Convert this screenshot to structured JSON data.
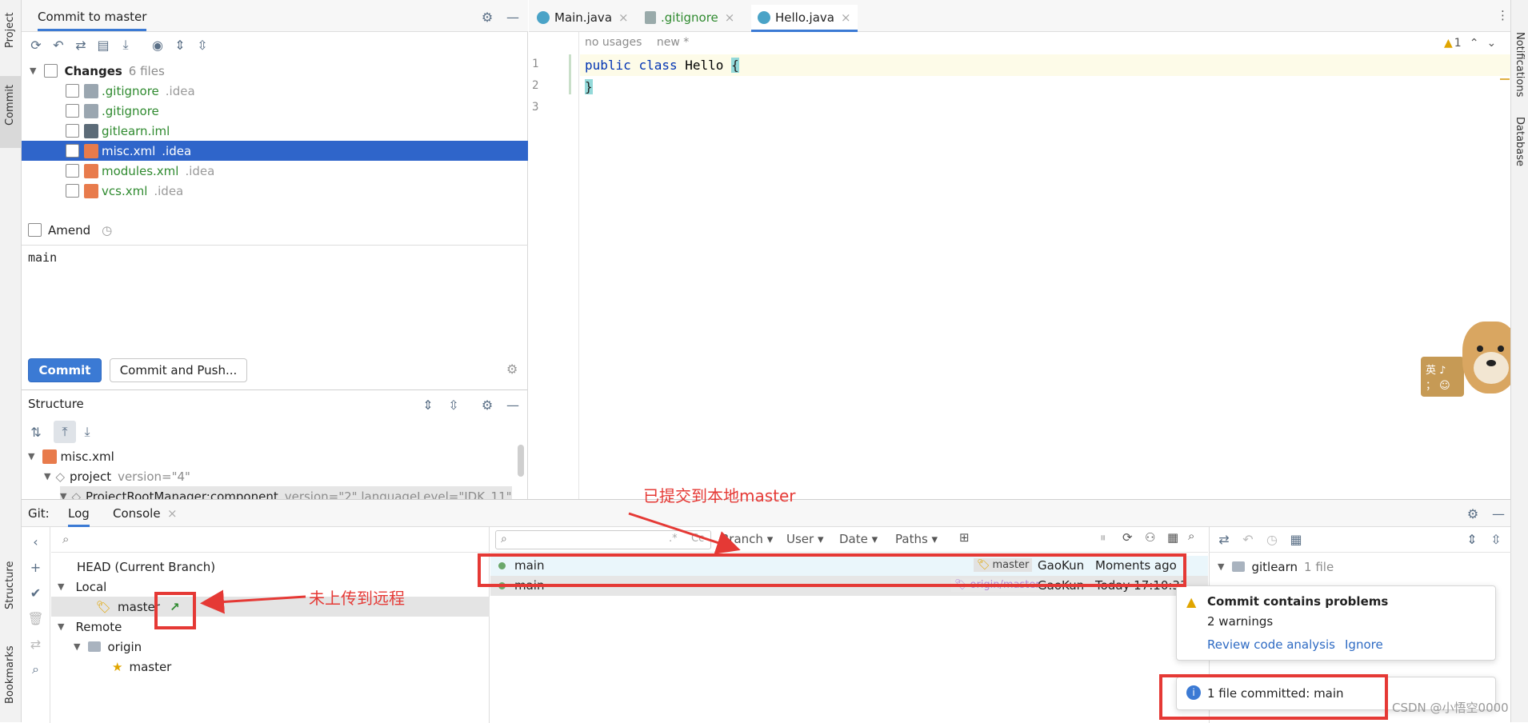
{
  "left_strip": {
    "project": "Project",
    "commit": "Commit",
    "structure": "Structure",
    "bookmarks": "Bookmarks"
  },
  "right_strip": {
    "notifications": "Notifications",
    "database": "Database"
  },
  "commit_panel": {
    "title": "Commit to master",
    "changes_label": "Changes",
    "changes_count": "6 files",
    "files": [
      {
        "name": ".gitignore",
        "dir": ".idea",
        "color": "#2f8a2f"
      },
      {
        "name": ".gitignore",
        "dir": "",
        "color": "#2f8a2f"
      },
      {
        "name": "gitlearn.iml",
        "dir": "",
        "color": "#2f8a2f"
      },
      {
        "name": "misc.xml",
        "dir": ".idea",
        "color": "#ffffff"
      },
      {
        "name": "modules.xml",
        "dir": ".idea",
        "color": "#2f8a2f"
      },
      {
        "name": "vcs.xml",
        "dir": ".idea",
        "color": "#2f8a2f"
      }
    ],
    "amend_label": "Amend",
    "message": "main",
    "commit_button": "Commit",
    "commit_push_button": "Commit and Push..."
  },
  "structure": {
    "title": "Structure",
    "nodes": [
      {
        "label": "misc.xml",
        "attr": ""
      },
      {
        "label": "project",
        "attr": "version=\"4\""
      },
      {
        "label": "ProjectRootManager:component",
        "attr": "version=\"2\" languageLevel=\"JDK_11\""
      }
    ]
  },
  "editor": {
    "tabs": [
      {
        "label": "Main.java",
        "color": "#222222"
      },
      {
        "label": ".gitignore",
        "color": "#2f8a2f"
      },
      {
        "label": "Hello.java",
        "color": "#222222"
      }
    ],
    "hint_usages": "no usages",
    "hint_new": "new *",
    "warning_count": "1",
    "line_numbers": [
      "1",
      "2",
      "3"
    ],
    "code_kw1": "public",
    "code_kw2": "class",
    "code_name": "Hello",
    "code_open": "{",
    "code_close": "}"
  },
  "bottom": {
    "git_label": "Git:",
    "tab_log": "Log",
    "tab_console": "Console",
    "branches": {
      "head": "HEAD (Current Branch)",
      "local": "Local",
      "local_master": "master",
      "remote": "Remote",
      "origin": "origin",
      "origin_master": "master"
    },
    "filters": {
      "branch": "Branch",
      "user": "User",
      "date": "Date",
      "paths": "Paths"
    },
    "search_regex": ".*",
    "search_case": "Cc",
    "commits": [
      {
        "message": "main",
        "tag": "master",
        "author": "GaoKun",
        "time": "Moments ago"
      },
      {
        "message": "main",
        "tag": "origin/master",
        "author": "GaoKun",
        "time": "Today 17:10:33"
      }
    ],
    "details_root": "gitlearn",
    "details_count": "1 file"
  },
  "popups": {
    "problems_title": "Commit contains problems",
    "problems_sub": "2 warnings",
    "review_link": "Review code analysis",
    "ignore_link": "Ignore",
    "committed": "1 file committed: main"
  },
  "annotations": {
    "local_commit": "已提交到本地master",
    "not_pushed": "未上传到远程"
  },
  "sticker": {
    "text1": "英 ♪",
    "text2": "；  ☺"
  },
  "watermark": "CSDN @小悟空0000",
  "colors": {
    "accent": "#3b7ad4",
    "selection": "#2f65ca",
    "annotation": "#e53935"
  }
}
